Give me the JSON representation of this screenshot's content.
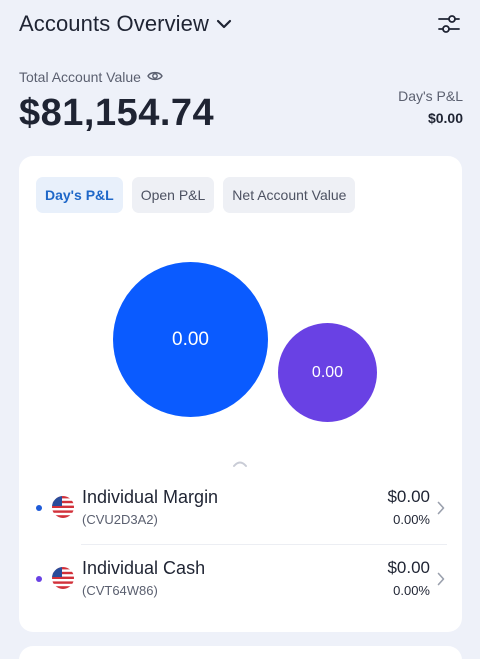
{
  "header": {
    "title": "Accounts Overview",
    "chevron_icon": "chevron-down-icon",
    "filter_icon": "sliders-icon"
  },
  "summary": {
    "total_label": "Total Account Value",
    "eye_icon": "eye-icon",
    "total_value": "$81,154.74",
    "pnl_label": "Day's P&L",
    "pnl_value": "$0.00"
  },
  "tabs": [
    {
      "label": "Day's P&L",
      "active": true
    },
    {
      "label": "Open P&L",
      "active": false
    },
    {
      "label": "Net Account Value",
      "active": false
    }
  ],
  "bubbles": [
    {
      "value": "0.00",
      "color": "#0a5bff"
    },
    {
      "value": "0.00",
      "color": "#6941e4"
    }
  ],
  "accounts": [
    {
      "name": "Individual Margin",
      "id": "(CVU2D3A2)",
      "value": "$0.00",
      "percent": "0.00%",
      "dot_color": "#1e5bd8",
      "flag_icon": "us-flag-icon"
    },
    {
      "name": "Individual Cash",
      "id": "(CVT64W86)",
      "value": "$0.00",
      "percent": "0.00%",
      "dot_color": "#6941e4",
      "flag_icon": "us-flag-icon"
    }
  ],
  "colors": {
    "accent": "#1e67c8",
    "background": "#eef1f9"
  }
}
